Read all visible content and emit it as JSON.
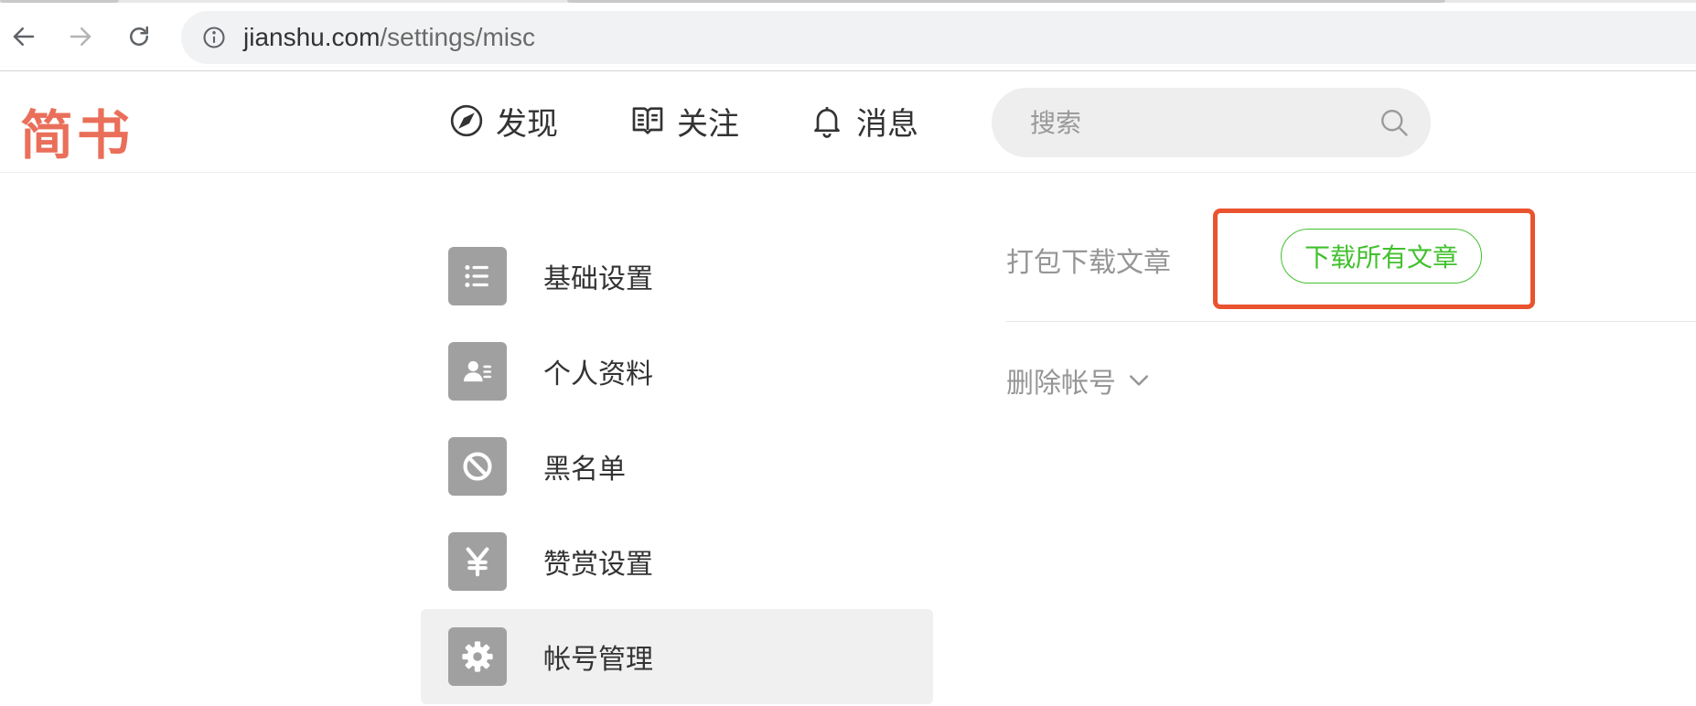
{
  "browser": {
    "url_host": "jianshu.com",
    "url_path": "/settings/misc"
  },
  "header": {
    "logo": "简书",
    "nav": [
      {
        "label": "发现",
        "icon": "compass-icon"
      },
      {
        "label": "关注",
        "icon": "book-icon"
      },
      {
        "label": "消息",
        "icon": "bell-icon"
      }
    ],
    "search": {
      "placeholder": "搜索"
    }
  },
  "sidebar": {
    "items": [
      {
        "label": "基础设置",
        "icon": "list-icon",
        "active": false
      },
      {
        "label": "个人资料",
        "icon": "profile-card-icon",
        "active": false
      },
      {
        "label": "黑名单",
        "icon": "block-icon",
        "active": false
      },
      {
        "label": "赞赏设置",
        "icon": "yen-icon",
        "active": false
      },
      {
        "label": "帐号管理",
        "icon": "gear-icon",
        "active": true
      }
    ]
  },
  "content": {
    "download_label": "打包下载文章",
    "download_button": "下载所有文章",
    "delete_label": "删除帐号"
  },
  "colors": {
    "brand": "#ea6f5a",
    "green": "#42c02e",
    "highlight": "#e9532f",
    "icon_bg": "#a0a0a0"
  }
}
